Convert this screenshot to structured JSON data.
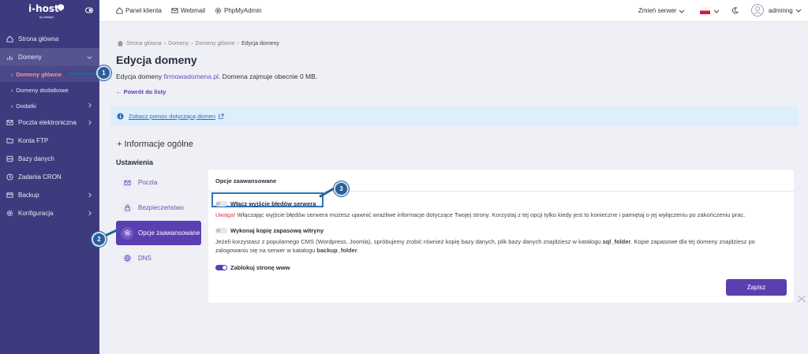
{
  "brand": {
    "name": "i-host",
    "sub": "by Webjet"
  },
  "colors": {
    "sidebar": "#3d3b7e",
    "accent": "#5b3fb0",
    "active_nav": "#ff8fa3",
    "warning": "#e0354c",
    "info_bg": "#dfeefc",
    "marker": "#2d5e9a"
  },
  "topbar": {
    "links": [
      {
        "label": "Panel klienta",
        "icon": "home-icon"
      },
      {
        "label": "Webmail",
        "icon": "mail-icon"
      },
      {
        "label": "PhpMyAdmin",
        "icon": "gear-icon"
      }
    ],
    "server_label": "Zmień serwer",
    "user": "adminng"
  },
  "sidebar": {
    "items": [
      {
        "label": "Strona główna",
        "icon": "home-icon"
      },
      {
        "label": "Domeny",
        "icon": "bar-chart-icon"
      },
      {
        "label": "Poczta elektroniczna",
        "icon": "mail-icon"
      },
      {
        "label": "Konta FTP",
        "icon": "ftp-icon"
      },
      {
        "label": "Bazy danych",
        "icon": "database-icon"
      },
      {
        "label": "Zadania CRON",
        "icon": "clock-icon"
      },
      {
        "label": "Backup",
        "icon": "backup-icon"
      },
      {
        "label": "Konfiguracja",
        "icon": "gear-icon"
      }
    ],
    "sub_items": [
      "Domeny główne",
      "Domeny dodatkowe",
      "Dodatki"
    ]
  },
  "breadcrumb": [
    "Strona główna",
    "Domeny",
    "Domeny główne",
    "Edycja domeny"
  ],
  "page": {
    "title": "Edycja domeny",
    "desc_prefix": "Edycja domeny",
    "domain": "firmowadomena.pl",
    "desc_suffix": ". Domena zajmuje obecnie 0 MB.",
    "back_label": "← Powrót do listy",
    "help_link": "Zobacz pomoc dotyczącą domen",
    "section_title": "+ Informacje ogólne",
    "settings_title": "Ustawienia"
  },
  "tabs": [
    {
      "label": "Poczta",
      "icon": "mail-icon"
    },
    {
      "label": "Bezpieczeństwo",
      "icon": "lock-icon"
    },
    {
      "label": "Opcje zaawansowane",
      "icon": "gear-icon"
    },
    {
      "label": "DNS",
      "icon": "globe-icon"
    }
  ],
  "panel": {
    "title": "Opcje zaawansowane",
    "opt1_label": "Włącz wyjście błędów serwera",
    "opt1_warn": "Uwaga!",
    "opt1_desc": " Włączając wyjście błędów serwera możesz ujawnić wrażliwe informacje dotyczące Twojej strony. Korzystaj z tej opcji tylko kiedy jest to konieczne i pamiętaj o jej wyłączeniu po zakończeniu prac.",
    "opt2_label": "Wykonaj kopię zapasową witryny",
    "opt2_desc_a": "Jeżeli korzystasz z popularnego CMS (Wordpress, Joomla), spróbujemy zrobić również kopię bazy danych, plik bazy danych znajdziesz w katalogu ",
    "opt2_folder1": "sql_folder",
    "opt2_desc_b": ". Kopie zapasowe dla tej domeny znajdziesz po",
    "opt2_desc_c": "zalogowaniu się na serwer w katalogu ",
    "opt2_folder2": "backup_folder",
    "opt2_desc_d": ".",
    "opt3_label": "Zablokuj stronę www",
    "save_label": "Zapisz"
  },
  "markers": [
    "1",
    "2",
    "3"
  ]
}
